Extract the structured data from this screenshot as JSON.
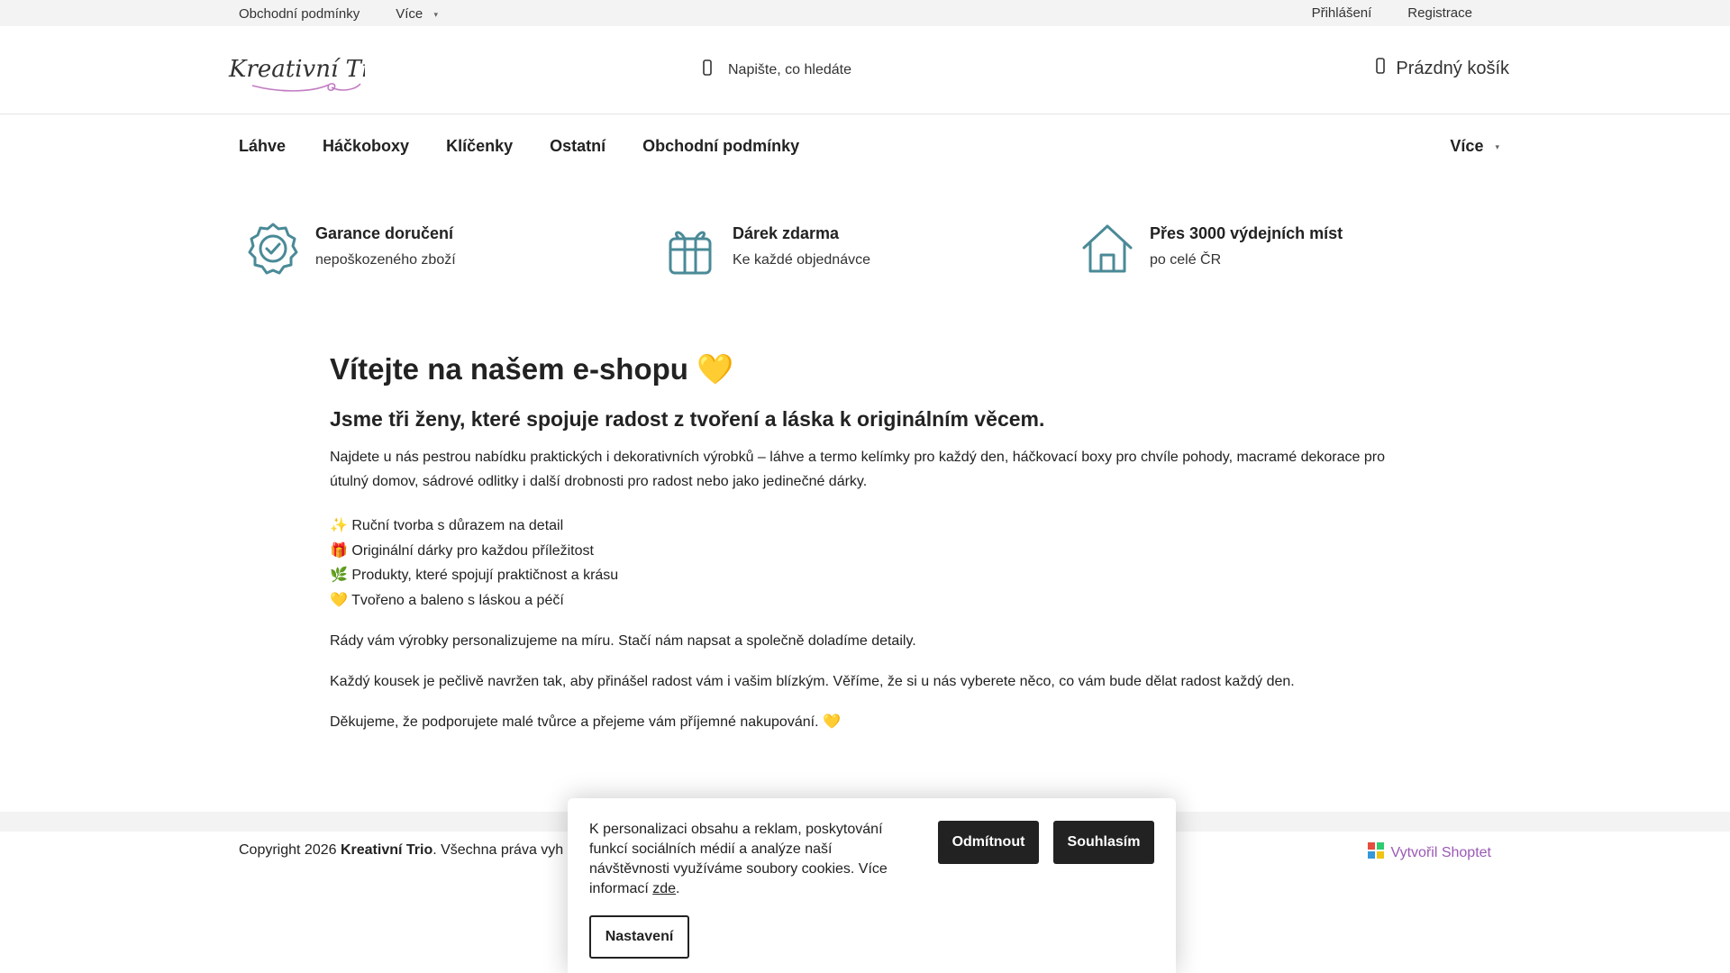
{
  "topbar": {
    "links": [
      "Obchodní podmínky",
      "Více"
    ],
    "account": [
      "Přihlášení",
      "Registrace"
    ]
  },
  "header": {
    "logo_text": "Kreativní Trio",
    "search_placeholder": "Napište, co hledáte",
    "cart_label": "Prázdný košík"
  },
  "nav": {
    "items": [
      "Láhve",
      "Háčkoboxy",
      "Klíčenky",
      "Ostatní",
      "Obchodní podmínky"
    ],
    "more_label": "Více"
  },
  "benefits": [
    {
      "title": "Garance doručení",
      "subtitle": "nepoškozeného zboží",
      "icon": "badge-check-icon"
    },
    {
      "title": "Dárek zdarma",
      "subtitle": "Ke každé objednávce",
      "icon": "gift-icon"
    },
    {
      "title": "Přes 3000 výdejních míst",
      "subtitle": "po celé ČR",
      "icon": "house-icon"
    }
  ],
  "content": {
    "heading": "Vítejte na našem e-shopu 💛",
    "subheading": "Jsme tři ženy, které spojuje radost z tvoření a láska k originálním věcem.",
    "intro": "Najdete u nás pestrou nabídku praktických i dekorativních výrobků – láhve a termo kelímky pro každý den, háčkovací boxy pro chvíle pohody, macramé dekorace pro útulný domov, sádrové odlitky i další drobnosti pro radost nebo jako jedinečné dárky.",
    "bullets": [
      "✨ Ruční tvorba s důrazem na detail",
      "🎁 Originální dárky pro každou příležitost",
      "🌿 Produkty, které spojují praktičnost a krásu",
      "💛 Tvořeno a baleno s láskou a péčí"
    ],
    "personalize": "Rády vám výrobky personalizujeme na míru. Stačí nám napsat a společně doladíme detaily.",
    "care": "Každý kousek je pečlivě navržen tak, aby přinášel radost vám i vašim blízkým. Věříme, že si u nás vyberete něco, co vám bude dělat radost každý den.",
    "thanks": "Děkujeme, že podporujete malé tvůrce a přejeme vám příjemné nakupování. 💛"
  },
  "footer": {
    "copyright_prefix": "Copyright 2026 ",
    "copyright_brand": "Kreativní Trio",
    "copyright_suffix": ". Všechna práva vyh",
    "shoptet_label": "Vytvořil Shoptet"
  },
  "cookie": {
    "text": "K personalizaci obsahu a reklam, poskytování funkcí sociálních médií a analýze naší návštěvnosti využíváme soubory cookies. Více informací ",
    "link_label": "zde",
    "text_end": ".",
    "reject_label": "Odmítnout",
    "accept_label": "Souhlasím",
    "settings_label": "Nastavení"
  },
  "colors": {
    "accent_teal": "#4a8a97",
    "shoptet_purple": "#9b59b6",
    "button_dark": "#222222",
    "topbar_bg": "#f3f3f3"
  }
}
